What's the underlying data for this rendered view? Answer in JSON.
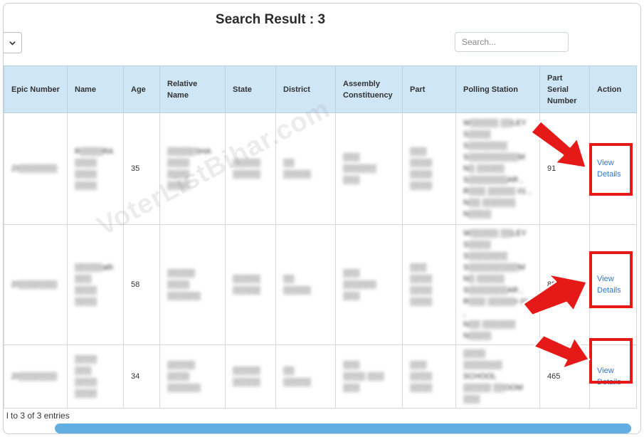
{
  "page": {
    "title": "Search Result : 3",
    "search_placeholder": "Search...",
    "entries_info": "l to 3 of 3 entries",
    "watermark": "VoterListBihar.com"
  },
  "colors": {
    "header_bg": "#cfe6f7",
    "link": "#2a78d8",
    "highlight": "#e61919",
    "scrollbar": "#62aee3"
  },
  "icons": {
    "select_caret": "chevron-down-icon",
    "annotation": "arrow-icon"
  },
  "table": {
    "columns": [
      "Epic Number",
      "Name",
      "Age",
      "Relative Name",
      "State",
      "District",
      "Assembly Constituency",
      "Part",
      "Polling Station",
      "Part Serial Number",
      "Action"
    ],
    "rows": [
      {
        "epic": "ZI▒▒▒▒▒▒▒",
        "name": "R▒▒▒▒RA\n▒▒▒▒\n▒▒▒▒\n▒▒▒▒",
        "age": "35",
        "relative": "▒▒▒▒▒SHA\n▒▒▒▒\n▒▒▒▒\n▒▒▒▒",
        "state": "▒▒▒▒▒\n▒▒▒▒▒",
        "district": "▒▒\n▒▒▒▒▒",
        "assembly": "▒▒▒\n▒▒▒▒▒▒\n▒▒▒",
        "part": "▒▒▒\n▒▒▒▒\n▒▒▒▒\n▒▒▒▒",
        "polling_station": "W▒▒▒▒▒ ▒▒LEY\nS▒▒▒▒\nS▒▒▒▒▒▒▒\nS▒▒▒▒▒▒▒▒▒M\nN▒ ▒▒▒▒▒\nS▒▒▒▒▒▒▒AR ,\nR▒▒▒ ▒▒▒▒▒ 01 ,\nN▒▒ ▒▒▒▒▒▒\nN▒▒▒▒",
        "serial": "91",
        "action": "View\nDetails"
      },
      {
        "epic": "ZI▒▒▒▒▒▒▒",
        "name": "▒▒▒▒▒ath\n▒▒▒\n▒▒▒▒\n▒▒▒▒",
        "age": "58",
        "relative": "▒▒▒▒▒\n▒▒▒▒\n▒▒▒▒▒▒",
        "state": "▒▒▒▒▒\n▒▒▒▒▒",
        "district": "▒▒\n▒▒▒▒▒",
        "assembly": "▒▒▒\n▒▒▒▒▒▒\n▒▒▒",
        "part": "▒▒▒\n▒▒▒▒\n▒▒▒▒\n▒▒▒▒",
        "polling_station": "W▒▒▒▒▒ ▒▒LEY\nS▒▒▒▒\nS▒▒▒▒▒▒▒\nS▒▒▒▒▒▒▒▒▒M\nN▒ ▒▒▒▒▒\nS▒▒▒▒▒▒▒AR ,\nR▒▒▒ ▒▒▒▒▒r 01 ,\nN▒▒ ▒▒▒▒▒▒\nN▒▒▒▒",
        "serial": "89",
        "action": "View\nDetails"
      },
      {
        "epic": "ZI▒▒▒▒▒▒▒",
        "name": "▒▒▒▒\n▒▒▒\n▒▒▒▒\n▒▒▒▒",
        "age": "34",
        "relative": "▒▒▒▒▒\n▒▒▒▒\n▒▒▒▒▒▒",
        "state": "▒▒▒▒▒\n▒▒▒▒▒",
        "district": "▒▒\n▒▒▒▒▒",
        "assembly": "▒▒▒\n▒▒▒▒ ▒▒▒\n▒▒▒",
        "part": "▒▒▒\n▒▒▒▒\n▒▒▒▒",
        "polling_station": "▒▒▒▒\n▒▒▒▒▒▒▒ SCHOOL\n▒▒▒▒▒ ▒▒OOM\n▒▒▒",
        "serial": "465",
        "action": "View\nDetails"
      }
    ]
  }
}
